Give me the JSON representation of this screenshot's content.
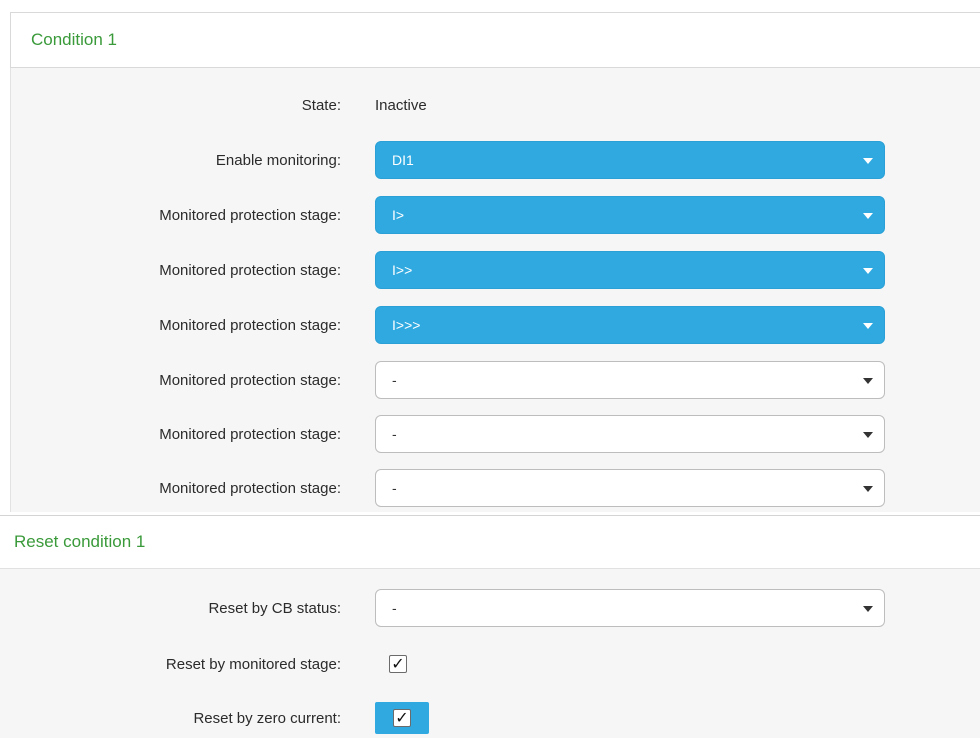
{
  "condition": {
    "title": "Condition 1",
    "state_label": "State:",
    "state_value": "Inactive",
    "enable_monitoring": {
      "label": "Enable monitoring:",
      "value": "DI1"
    },
    "stages": [
      {
        "label": "Monitored protection stage:",
        "value": "I>"
      },
      {
        "label": "Monitored protection stage:",
        "value": "I>>"
      },
      {
        "label": "Monitored protection stage:",
        "value": "I>>>"
      },
      {
        "label": "Monitored protection stage:",
        "value": "-"
      },
      {
        "label": "Monitored protection stage:",
        "value": "-"
      },
      {
        "label": "Monitored protection stage:",
        "value": "-"
      }
    ]
  },
  "reset": {
    "title": "Reset condition 1",
    "cb_status": {
      "label": "Reset by CB status:",
      "value": "-"
    },
    "monitored_stage": {
      "label": "Reset by monitored stage:",
      "checked": true
    },
    "zero_current": {
      "label": "Reset by zero current:",
      "checked": true
    }
  },
  "icons": {
    "dropdown": "chevron-down-icon",
    "check": "checkmark-icon"
  },
  "colors": {
    "accent_blue": "#2fa9e0",
    "section_title_green": "#3a9a3a",
    "panel_bg": "#f6f6f6"
  }
}
